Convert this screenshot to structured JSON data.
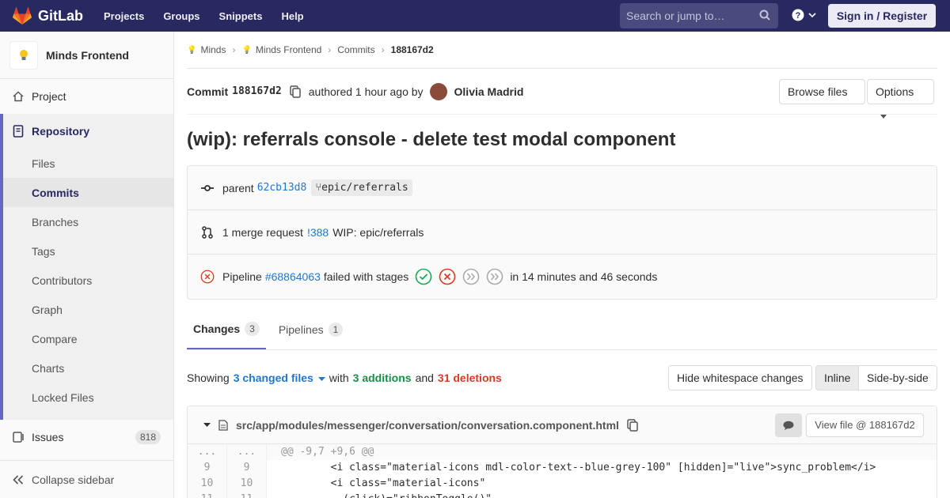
{
  "nav": {
    "brand": "GitLab",
    "links": [
      "Projects",
      "Groups",
      "Snippets",
      "Help"
    ],
    "search_placeholder": "Search or jump to…",
    "signin": "Sign in / Register"
  },
  "sidebar": {
    "project_name": "Minds Frontend",
    "project_item": "Project",
    "repository": "Repository",
    "repo_items": [
      "Files",
      "Commits",
      "Branches",
      "Tags",
      "Contributors",
      "Graph",
      "Compare",
      "Charts",
      "Locked Files"
    ],
    "issues": "Issues",
    "issues_count": "818",
    "collapse": "Collapse sidebar"
  },
  "breadcrumb": [
    "Minds",
    "Minds Frontend",
    "Commits",
    "188167d2"
  ],
  "commit": {
    "label": "Commit",
    "sha": "188167d2",
    "authored": "authored 1 hour ago by",
    "author": "Olivia Madrid",
    "browse": "Browse files",
    "options": "Options",
    "title": "(wip): referrals console - delete test modal component",
    "parent_label": "parent",
    "parent_sha": "62cb13d8",
    "branch": "epic/referrals",
    "mr_text": "1 merge request",
    "mr_link": "!388",
    "mr_title": "WIP: epic/referrals",
    "pipeline_label": "Pipeline",
    "pipeline_link": "#68864063",
    "pipeline_status": "failed with stages",
    "pipeline_duration": "in 14 minutes and 46 seconds"
  },
  "tabs": [
    {
      "label": "Changes",
      "count": "3"
    },
    {
      "label": "Pipelines",
      "count": "1"
    }
  ],
  "summary": {
    "showing": "Showing",
    "files": "3 changed files",
    "with": "with",
    "additions": "3 additions",
    "and": "and",
    "deletions": "31 deletions",
    "hide_ws": "Hide whitespace changes",
    "inline": "Inline",
    "side": "Side-by-side"
  },
  "file": {
    "path": "src/app/modules/messenger/conversation/conversation.component.html",
    "view": "View file @ 188167d2"
  },
  "diff": [
    {
      "old": "...",
      "new": "...",
      "text": "@@ -9,7 +9,6 @@"
    },
    {
      "old": "9",
      "new": "9",
      "text": "        <i class=\"material-icons mdl-color-text--blue-grey-100\" [hidden]=\"live\">sync_problem</i>"
    },
    {
      "old": "10",
      "new": "10",
      "text": "        <i class=\"material-icons\""
    },
    {
      "old": "11",
      "new": "11",
      "text": "          (click)=\"ribbonToggle()\""
    }
  ]
}
